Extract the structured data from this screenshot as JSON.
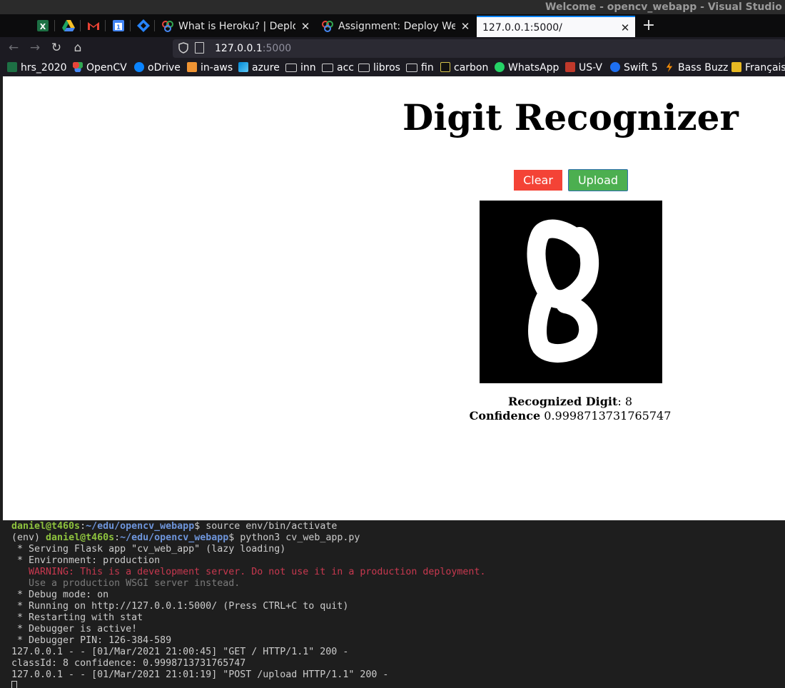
{
  "os_title": "Welcome - opencv_webapp - Visual Studio Code",
  "tabs": [
    {
      "label": "What is Heroku? | Deploy",
      "close": "✕"
    },
    {
      "label": "Assignment: Deploy Web",
      "close": "✕"
    },
    {
      "label": "127.0.0.1:5000/",
      "close": "✕"
    }
  ],
  "new_tab": "+",
  "nav": {
    "back": "←",
    "forward": "→",
    "reload": "↻",
    "home": "⌂"
  },
  "url": {
    "host": "127.0.0.1",
    "port": ":5000"
  },
  "bookmarks": [
    "hrs_2020",
    "OpenCV",
    "oDrive",
    "in-aws",
    "azure",
    "inn",
    "acc",
    "libros",
    "fin",
    "carbon",
    "WhatsApp",
    "US-V",
    "Swift 5",
    "Bass Buzz",
    "Français"
  ],
  "page": {
    "title": "Digit Recognizer",
    "clear_label": "Clear",
    "upload_label": "Upload",
    "recognized_label": "Recognized Digit",
    "recognized_value": ": 8",
    "confidence_label": "Confidence",
    "confidence_value": " 0.9998713731765747"
  },
  "terminal": {
    "user": "daniel@t460s",
    "path": "~/edu/opencv_webapp",
    "cmd1": "$ source env/bin/activate",
    "env": "(env) ",
    "cmd2": "$ python3 cv_web_app.py",
    "lines": [
      " * Serving Flask app \"cv_web_app\" (lazy loading)",
      " * Environment: production"
    ],
    "warning": "   WARNING: This is a development server. Do not use it in a production deployment.",
    "hint": "   Use a production WSGI server instead.",
    "lines2": [
      " * Debug mode: on",
      " * Running on http://127.0.0.1:5000/ (Press CTRL+C to quit)",
      " * Restarting with stat",
      " * Debugger is active!",
      " * Debugger PIN: 126-384-589",
      "127.0.0.1 - - [01/Mar/2021 21:00:45] \"GET / HTTP/1.1\" 200 -",
      "classId: 8 confidence: 0.9998713731765747",
      "127.0.0.1 - - [01/Mar/2021 21:01:19] \"POST /upload HTTP/1.1\" 200 -"
    ]
  }
}
